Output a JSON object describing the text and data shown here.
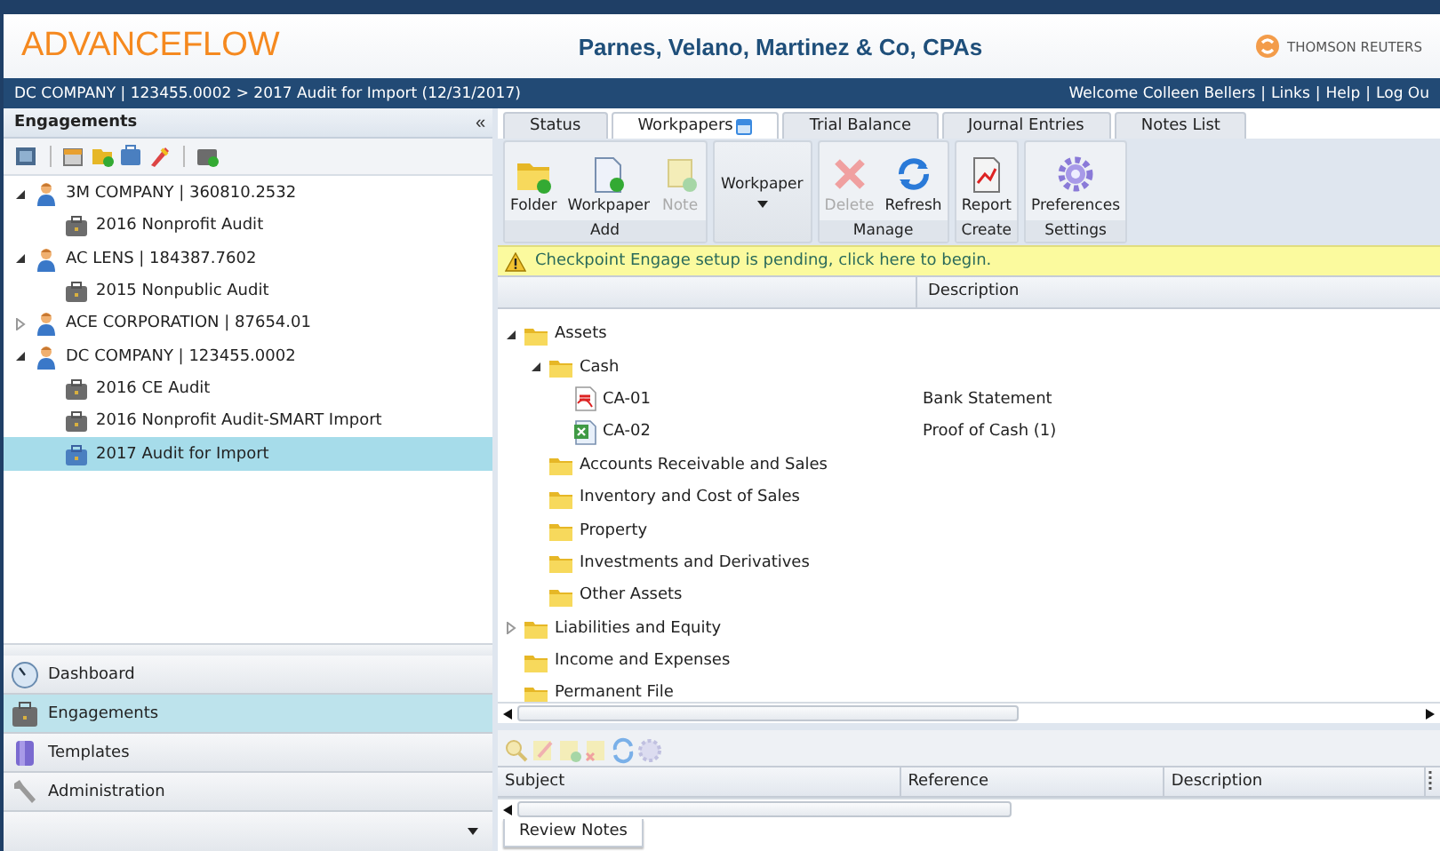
{
  "header": {
    "product": "ADVANCEFLOW",
    "firm": "Parnes, Velano, Martinez & Co, CPAs",
    "vendor": "THOMSON REUTERS"
  },
  "nav_bar": {
    "breadcrumb": "DC COMPANY | 123455.0002 > 2017 Audit for Import (12/31/2017)",
    "welcome": "Welcome  Colleen Bellers",
    "separator": "|",
    "links": [
      "Links",
      "Help",
      "Log Ou"
    ]
  },
  "engagements_panel": {
    "title": "Engagements",
    "collapse": "«",
    "clients": [
      {
        "name": "3M COMPANY | 360810.2532",
        "expanded": true,
        "children": [
          {
            "name": "2016 Nonprofit Audit",
            "selected": false
          }
        ]
      },
      {
        "name": "AC LENS | 184387.7602",
        "expanded": true,
        "children": [
          {
            "name": "2015 Nonpublic Audit",
            "selected": false
          }
        ]
      },
      {
        "name": "ACE CORPORATION | 87654.01",
        "expanded": false
      },
      {
        "name": "DC COMPANY | 123455.0002",
        "expanded": true,
        "children": [
          {
            "name": "2016 CE Audit",
            "selected": false
          },
          {
            "name": "2016 Nonprofit Audit-SMART Import",
            "selected": false
          },
          {
            "name": "2017 Audit for Import",
            "selected": true
          }
        ]
      }
    ]
  },
  "navigation": [
    {
      "label": "Dashboard",
      "kind": "clock",
      "selected": false
    },
    {
      "label": "Engagements",
      "kind": "briefcase",
      "selected": true
    },
    {
      "label": "Templates",
      "kind": "cylinder",
      "selected": false
    },
    {
      "label": "Administration",
      "kind": "wrench",
      "selected": false
    }
  ],
  "tabs": [
    {
      "label": "Status",
      "selected": false
    },
    {
      "label": "Workpapers",
      "selected": true
    },
    {
      "label": "Trial Balance",
      "selected": false
    },
    {
      "label": "Journal Entries",
      "selected": false
    },
    {
      "label": "Notes List",
      "selected": false
    }
  ],
  "ribbon": [
    {
      "group": "Add",
      "buttons": [
        {
          "label": "Folder",
          "kind": "folder",
          "disabled": false
        },
        {
          "label": "Workpaper",
          "kind": "document",
          "disabled": false
        },
        {
          "label": "Note",
          "kind": "note",
          "disabled": true
        }
      ]
    },
    {
      "buttons": [
        {
          "label": "Workpaper",
          "kind": "dropdown",
          "disabled": false
        }
      ]
    },
    {
      "group": "Manage",
      "buttons": [
        {
          "label": "Delete",
          "kind": "delete",
          "disabled": true
        },
        {
          "label": "Refresh",
          "kind": "refresh",
          "disabled": false
        }
      ]
    },
    {
      "group": "Create",
      "buttons": [
        {
          "label": "Report",
          "kind": "report",
          "disabled": false
        }
      ]
    },
    {
      "group": "Settings",
      "buttons": [
        {
          "label": "Preferences",
          "kind": "gear",
          "disabled": false
        }
      ]
    }
  ],
  "banner": "Checkpoint Engage setup is pending, click here to begin.",
  "workpapers": {
    "columns": [
      "Description"
    ],
    "tree": [
      {
        "name": "Assets",
        "kind": "folder",
        "expanded": true,
        "children": [
          {
            "name": "Cash",
            "kind": "folder",
            "expanded": true,
            "children": [
              {
                "name": "CA-01",
                "kind": "pdf",
                "description": "Bank Statement"
              },
              {
                "name": "CA-02",
                "kind": "excel",
                "description": "Proof of Cash (1)"
              }
            ]
          },
          {
            "name": "Accounts Receivable and Sales",
            "kind": "folder"
          },
          {
            "name": "Inventory and Cost of Sales",
            "kind": "folder"
          },
          {
            "name": "Property",
            "kind": "folder"
          },
          {
            "name": "Investments and Derivatives",
            "kind": "folder"
          },
          {
            "name": "Other Assets",
            "kind": "folder"
          }
        ]
      },
      {
        "name": "Liabilities and Equity",
        "kind": "folder",
        "expanded": false
      },
      {
        "name": "Income and Expenses",
        "kind": "folder"
      },
      {
        "name": "Permanent File",
        "kind": "folder"
      }
    ]
  },
  "review_notes": {
    "columns": [
      "Subject",
      "Reference",
      "Description"
    ],
    "tabs": [
      {
        "label": "Review Notes",
        "selected": true
      }
    ]
  }
}
